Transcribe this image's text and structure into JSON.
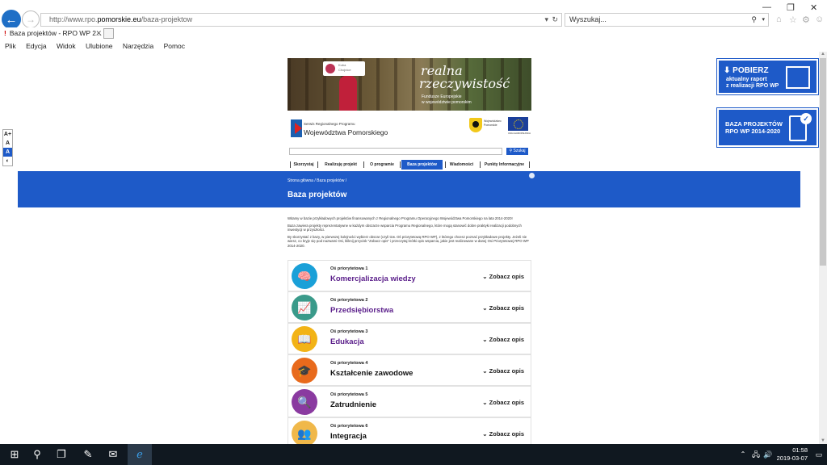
{
  "browser": {
    "url_prefix": "http://www.rpo.",
    "url_domain": "pomorskie.eu",
    "url_path": "/baza-projektow",
    "search_placeholder": "Wyszukaj...",
    "tab_title": "Baza projektów - RPO WP 2...",
    "tab_favicon": "!",
    "menu": [
      "Plik",
      "Edycja",
      "Widok",
      "Ulubione",
      "Narzędzia",
      "Pomoc"
    ]
  },
  "font_tools": [
    "A+",
    "A",
    "A",
    "◐"
  ],
  "banner": {
    "card_name": "Kuba\nChojnice",
    "headline1": "realna",
    "headline2": "rzeczywistość",
    "sub": "Fundusze Europejskie\nw województwie pomorskim"
  },
  "logo": {
    "line1": "Serwis Regionalnego Programu",
    "line2": "Województwa Pomorskiego",
    "pom_text": "Województwo\nPomorskie",
    "eu_text": "UNIA EUROPEJSKA"
  },
  "site_search_button": "Szukaj",
  "nav": [
    "Skorzystaj",
    "Realizuję projekt",
    "O programie",
    "Baza projektów",
    "Wiadomości",
    "Punkty Informacyjne"
  ],
  "hero": {
    "breadcrumb": "Strona główna  /  Baza projektów  /",
    "title": "Baza projektów"
  },
  "intro": {
    "p1": "Witamy w bazie przykładowych projektów finansowanych z Regionalnego Programu Operacyjnego Województwa Pomorskiego na lata 2014-2020!",
    "p2": "Baza zawiera projekty reprezentatywne w każdym obszarze wsparcia Programu Regionalnego, które mogą stanowić dobre praktyki realizacji podobnych inwestycji w przyszłości.",
    "p3": "By skorzystać z bazy, w pierwszej kolejności wybierz obszar (czyli tzw. Oś priorytetową RPO WP), z którego chcesz poznać przykładowe projekty. Jeżeli nie wiesz, co kryje się pod nazwami Osi, kliknij przycisk \"Zobacz opis\" i przeczytaj krótki opis wsparcia, jakie jest realizowane w danej Osi Priorytetowej RPO WP 2014-2020."
  },
  "side": {
    "b1_title": "POBIERZ",
    "b1_sub": "aktualny raport\nz realizacji RPO WP",
    "b2_title": "BAZA PROJEKTÓW\nRPO WP 2014-2020"
  },
  "axes": [
    {
      "label": "Oś priorytetowa 1",
      "name": "Komercjalizacja wiedzy",
      "color": "#1aa0d8",
      "name_color": "#5a1e8a",
      "icon": "🧠"
    },
    {
      "label": "Oś priorytetowa 2",
      "name": "Przedsiębiorstwa",
      "color": "#3a9a8a",
      "name_color": "#5a1e8a",
      "icon": "📈"
    },
    {
      "label": "Oś priorytetowa 3",
      "name": "Edukacja",
      "color": "#f2b316",
      "name_color": "#5a1e8a",
      "icon": "📖"
    },
    {
      "label": "Oś priorytetowa 4",
      "name": "Kształcenie zawodowe",
      "color": "#e86a1c",
      "name_color": "#111",
      "icon": "🎓"
    },
    {
      "label": "Oś priorytetowa 5",
      "name": "Zatrudnienie",
      "color": "#8a3aa0",
      "name_color": "#111",
      "icon": "🔍"
    },
    {
      "label": "Oś priorytetowa 6",
      "name": "Integracja",
      "color": "#f0b84a",
      "name_color": "#111",
      "icon": "👥"
    }
  ],
  "see_more": "Zobacz opis",
  "taskbar": {
    "time": "01:58",
    "date": "2019-03-07"
  }
}
